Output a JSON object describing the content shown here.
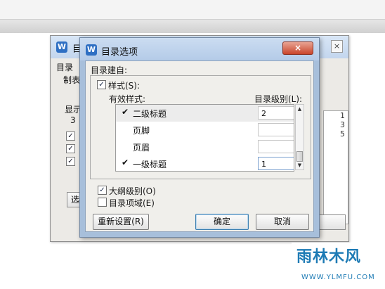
{
  "back_dialog": {
    "title": "目",
    "labels": [
      "目录",
      "制表",
      "显示",
      "3"
    ],
    "checkboxes": [
      "✓",
      "✓",
      "✓"
    ],
    "preview_values": [
      "1",
      "3",
      "5"
    ],
    "options_button": "选",
    "close_glyph": "×"
  },
  "dialog": {
    "title": "目录选项",
    "close_glyph": "×",
    "group_label": "目录建自:",
    "styles_checkbox": {
      "label": "样式(S):",
      "checked": true
    },
    "col_styles": "有效样式:",
    "col_level": "目录级别(L):",
    "styles": [
      {
        "name": "二级标题",
        "checked": true,
        "level": "2",
        "selected": true
      },
      {
        "name": "页脚",
        "checked": false,
        "level": ""
      },
      {
        "name": "页眉",
        "checked": false,
        "level": ""
      },
      {
        "name": "一级标题",
        "checked": true,
        "level": "1",
        "focused": true
      }
    ],
    "outline_checkbox": {
      "label": "大纲级别(O)",
      "checked": true
    },
    "fields_checkbox": {
      "label": "目录项域(E)",
      "checked": false
    },
    "buttons": {
      "reset": "重新设置(R)",
      "ok": "确定",
      "cancel": "取消"
    }
  },
  "watermark": {
    "main": "雨林木风",
    "sub": "WWW.YLMFU.COM"
  },
  "colors": {
    "titlebar": "#b4cbe8",
    "close_button": "#c9452b",
    "accent": "#1e7bb5"
  }
}
